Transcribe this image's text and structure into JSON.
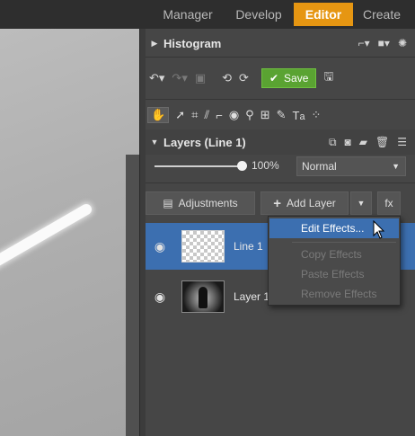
{
  "tabs": [
    "Manager",
    "Develop",
    "Editor",
    "Create"
  ],
  "active_tab": "Editor",
  "histogram": {
    "title": "Histogram"
  },
  "toolbar": {
    "save_label": "Save"
  },
  "layers": {
    "title": "Layers (Line 1)",
    "opacity": "100%",
    "blend_mode": "Normal",
    "adjustments_label": "Adjustments",
    "add_layer_label": "Add Layer",
    "fx_label": "fx",
    "items": [
      {
        "name": "Line 1",
        "selected": true
      },
      {
        "name": "Layer 1",
        "selected": false
      }
    ]
  },
  "context_menu": {
    "items": [
      {
        "label": "Edit Effects...",
        "state": "hover"
      },
      {
        "label": "Copy Effects",
        "state": "disabled"
      },
      {
        "label": "Paste Effects",
        "state": "disabled"
      },
      {
        "label": "Remove Effects",
        "state": "disabled"
      }
    ]
  },
  "colors": {
    "accent": "#e69612",
    "selection": "#3c6fb0",
    "save_green": "#5aa332"
  },
  "icons": [
    "undo-icon",
    "redo-icon",
    "rotate-left-icon",
    "rotate-right-icon",
    "save-disk-icon",
    "hand-icon",
    "arrow-select-icon",
    "crop-icon",
    "eye-icon",
    "folder-icon",
    "trash-icon",
    "menu-icon",
    "gear-icon",
    "mask-icon"
  ]
}
